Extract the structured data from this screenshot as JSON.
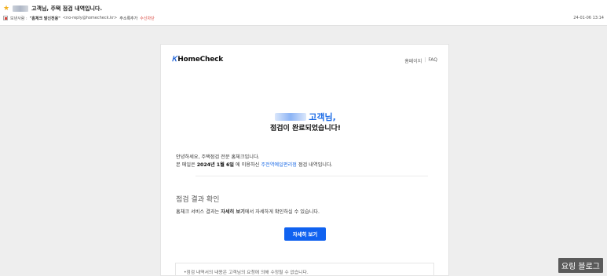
{
  "mail": {
    "subject": "고객님, 주택 점검 내역입니다.",
    "sender_label": "보낸사람 :",
    "sender_name": "\"홈체크 발신전용\"",
    "sender_email": "<no-reply@homecheck.kr>",
    "add_contact": "주소록추가",
    "block": "수신차단",
    "date": "24-01-06 13:14"
  },
  "card": {
    "logo_mark": "Ꮶ",
    "logo_text": "HomeCheck",
    "links": [
      "홈페이지",
      "FAQ"
    ],
    "link_sep": "|",
    "greeting": "고객님,",
    "done": "점검이 완료되었습니다!",
    "intro_line1": "안녕하세요, 주택점검 전문 홈체크입니다.",
    "intro_prefix": "본 메일은 ",
    "intro_date": "2024년 1월 6일",
    "intro_mid": " 에 이용하신 ",
    "intro_service": "주전역예일편리점",
    "intro_suffix": " 점검 내역입니다.",
    "section_title": "점검 결과 확인",
    "desc_prefix": "홈체크 서비스 결과는 ",
    "desc_bold": "자세히 보기",
    "desc_suffix": "에서 자세하게 확인하실 수 있습니다.",
    "detail_button": "자세히 보기",
    "notice": "•점검 내역서의 내용은 고객님의 요청에 의해 수정될 수 없습니다."
  },
  "watermark": "요링 블로그",
  "colors": {
    "accent": "#1062f0",
    "star": "#f2b01e",
    "block": "#d9423a"
  },
  "icons": {
    "star": "star-icon",
    "sender": "sender-checkbox-icon"
  }
}
